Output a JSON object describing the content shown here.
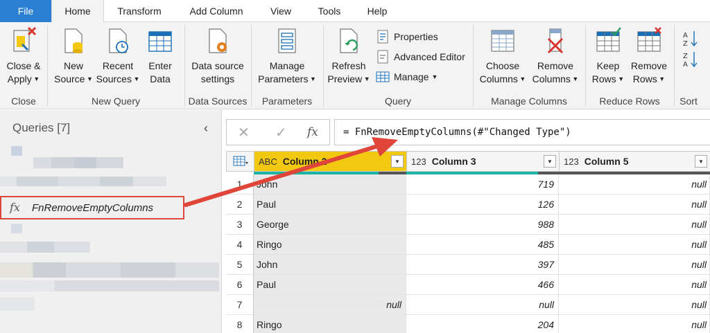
{
  "tabs": [
    "File",
    "Home",
    "Transform",
    "Add Column",
    "View",
    "Tools",
    "Help"
  ],
  "ribbon": {
    "close_apply": "Close &\nApply",
    "new_source": "New\nSource",
    "recent_sources": "Recent\nSources",
    "enter_data": "Enter\nData",
    "data_source_settings": "Data source\nsettings",
    "manage_parameters": "Manage\nParameters",
    "refresh_preview": "Refresh\nPreview",
    "properties": "Properties",
    "advanced_editor": "Advanced Editor",
    "manage": "Manage",
    "choose_columns": "Choose\nColumns",
    "remove_columns": "Remove\nColumns",
    "keep_rows": "Keep\nRows",
    "remove_rows": "Remove\nRows",
    "groups": {
      "close": "Close",
      "new_query": "New Query",
      "data_sources": "Data Sources",
      "parameters": "Parameters",
      "query": "Query",
      "manage_columns": "Manage Columns",
      "reduce_rows": "Reduce Rows",
      "sort": "Sort"
    }
  },
  "queries": {
    "title": "Queries [7]",
    "function_name": "FnRemoveEmptyColumns"
  },
  "formula_bar": {
    "cancel": "✕",
    "commit": "✓",
    "fx": "fx",
    "formula": "= FnRemoveEmptyColumns(#\"Changed Type\")"
  },
  "grid": {
    "columns": [
      {
        "type": "ABC",
        "name": "Column 2"
      },
      {
        "type": "123",
        "name": "Column 3"
      },
      {
        "type": "123",
        "name": "Column 5"
      }
    ],
    "rows": [
      {
        "n": "1",
        "c2": "John",
        "c3": "719",
        "c5": "null"
      },
      {
        "n": "2",
        "c2": "Paul",
        "c3": "126",
        "c5": "null"
      },
      {
        "n": "3",
        "c2": "George",
        "c3": "988",
        "c5": "null"
      },
      {
        "n": "4",
        "c2": "Ringo",
        "c3": "485",
        "c5": "null"
      },
      {
        "n": "5",
        "c2": "John",
        "c3": "397",
        "c5": "null"
      },
      {
        "n": "6",
        "c2": "Paul",
        "c3": "466",
        "c5": "null"
      },
      {
        "n": "7",
        "c2": "null",
        "c3": "null",
        "c5": "null"
      },
      {
        "n": "8",
        "c2": "Ringo",
        "c3": "204",
        "c5": "null"
      }
    ]
  },
  "colors": {
    "file_tab": "#2b7fd5",
    "selected_header": "#f2c811",
    "quality_valid": "#1cb5a3",
    "annotation": "#e0453a"
  },
  "icons": {
    "collapse": "chevron-left-icon",
    "function": "fx-icon"
  }
}
